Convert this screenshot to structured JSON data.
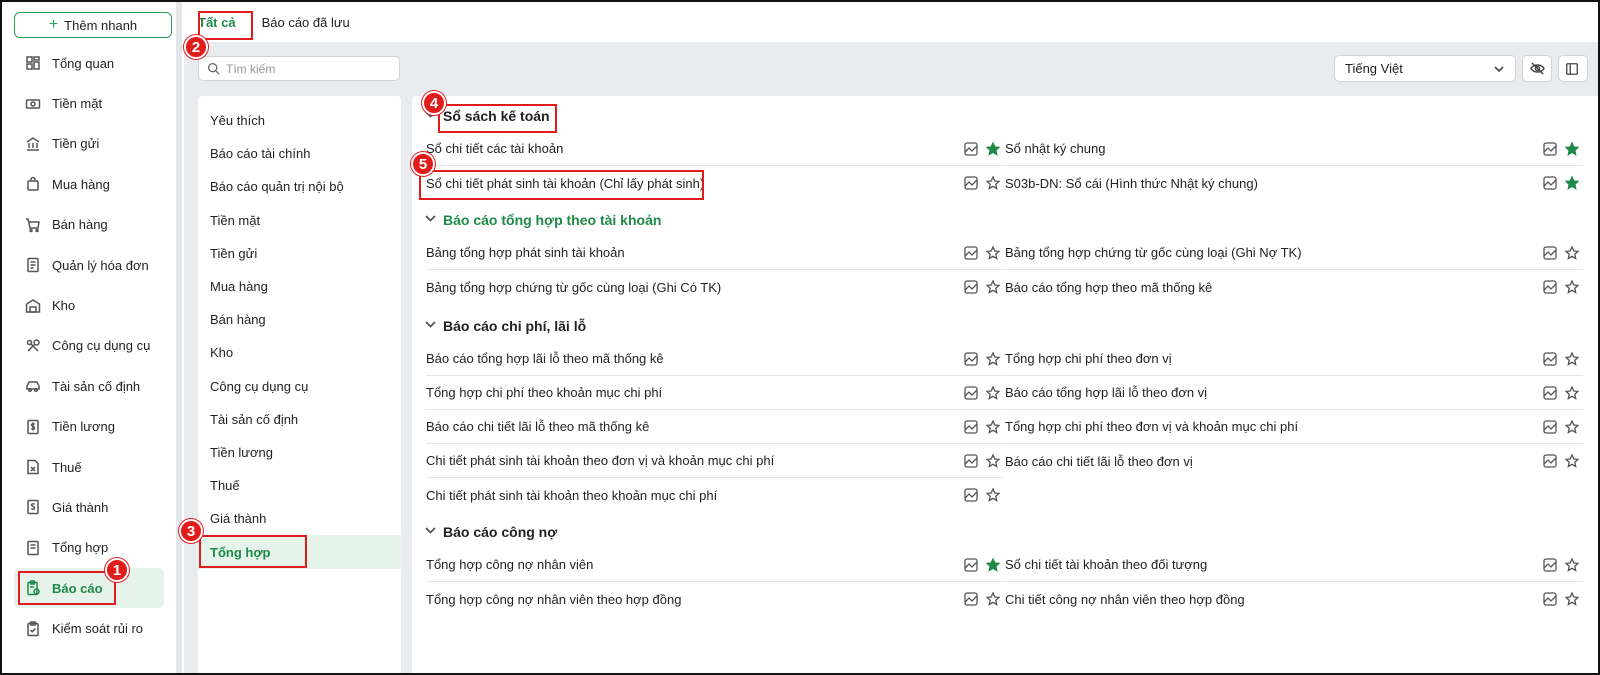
{
  "quick_add": {
    "label": "Thêm nhanh"
  },
  "sidebar": {
    "items": [
      {
        "label": "Tổng quan",
        "icon": "dashboard-icon"
      },
      {
        "label": "Tiền mặt",
        "icon": "cash-icon"
      },
      {
        "label": "Tiền gửi",
        "icon": "bank-icon"
      },
      {
        "label": "Mua hàng",
        "icon": "bag-icon"
      },
      {
        "label": "Bán hàng",
        "icon": "cart-icon"
      },
      {
        "label": "Quản lý hóa đơn",
        "icon": "invoice-icon"
      },
      {
        "label": "Kho",
        "icon": "warehouse-icon"
      },
      {
        "label": "Công cụ dụng cụ",
        "icon": "tools-icon"
      },
      {
        "label": "Tài sản cố định",
        "icon": "car-icon"
      },
      {
        "label": "Tiền lương",
        "icon": "salary-icon"
      },
      {
        "label": "Thuế",
        "icon": "tax-icon"
      },
      {
        "label": "Giá thành",
        "icon": "price-icon"
      },
      {
        "label": "Tổng hợp",
        "icon": "summary-icon"
      },
      {
        "label": "Báo cáo",
        "icon": "report-icon",
        "active": true
      },
      {
        "label": "Kiểm soát rủi ro",
        "icon": "risk-icon"
      }
    ]
  },
  "tabs": [
    {
      "label": "Tất cả",
      "active": true
    },
    {
      "label": "Báo cáo đã lưu",
      "active": false
    }
  ],
  "search": {
    "placeholder": "Tìm kiếm"
  },
  "language": {
    "value": "Tiếng Việt"
  },
  "categories": [
    "Yêu thích",
    "Báo cáo tài chính",
    "Báo cáo quản trị nội bộ",
    "Tiền mặt",
    "Tiền gửi",
    "Mua hàng",
    "Bán hàng",
    "Kho",
    "Công cụ dụng cụ",
    "Tài sản cố định",
    "Tiền lương",
    "Thuế",
    "Giá thành",
    "Tổng hợp"
  ],
  "active_category": "Tổng hợp",
  "sections": [
    {
      "title": "Sổ sách kế toán",
      "left": [
        {
          "label": "Sổ chi tiết các tài khoản",
          "fav": true
        },
        {
          "label": "Sổ chi tiết phát sinh tài khoản (Chỉ lấy phát sinh)",
          "fav": false
        }
      ],
      "right": [
        {
          "label": "Sổ nhật ký chung",
          "fav": true
        },
        {
          "label": "S03b-DN: Sổ cái (Hình thức Nhật ký chung)",
          "fav": true
        }
      ]
    },
    {
      "title": "Báo cáo tổng hợp theo tài khoản",
      "left": [
        {
          "label": "Bảng tổng hợp phát sinh tài khoản",
          "fav": false
        },
        {
          "label": "Bảng tổng hợp chứng từ gốc cùng loại (Ghi Có TK)",
          "fav": false
        }
      ],
      "right": [
        {
          "label": "Bảng tổng hợp chứng từ gốc cùng loại (Ghi Nợ TK)",
          "fav": false
        },
        {
          "label": "Báo cáo tổng hợp theo mã thống kê",
          "fav": false
        }
      ]
    },
    {
      "title": "Báo cáo chi phí, lãi lỗ",
      "left": [
        {
          "label": "Báo cáo tổng hợp lãi lỗ theo mã thống kê",
          "fav": false
        },
        {
          "label": "Tổng hợp chi phí theo khoản mục chi phí",
          "fav": false
        },
        {
          "label": "Báo cáo chi tiết lãi lỗ theo mã thống kê",
          "fav": false
        },
        {
          "label": "Chi tiết phát sinh tài khoản theo đơn vị và khoản mục chi phí",
          "fav": false
        },
        {
          "label": "Chi tiết phát sinh tài khoản theo khoản mục chi phí",
          "fav": false
        }
      ],
      "right": [
        {
          "label": "Tổng hợp chi phí theo đơn vị",
          "fav": false
        },
        {
          "label": "Báo cáo tổng hợp lãi lỗ theo đơn vị",
          "fav": false
        },
        {
          "label": "Tổng hợp chi phí theo đơn vị và khoản mục chi phí",
          "fav": false
        },
        {
          "label": "Báo cáo chi tiết lãi lỗ theo đơn vị",
          "fav": false
        }
      ]
    },
    {
      "title": "Báo cáo công nợ",
      "left": [
        {
          "label": "Tổng hợp công nợ nhân viên",
          "fav": true
        },
        {
          "label": "Tổng hợp công nợ nhân viên theo hợp đồng",
          "fav": false
        }
      ],
      "right": [
        {
          "label": "Sổ chi tiết tài khoản theo đối tượng",
          "fav": false
        },
        {
          "label": "Chi tiết công nợ nhân viên theo hợp đồng",
          "fav": false
        }
      ]
    }
  ],
  "annotations": [
    "1",
    "2",
    "3",
    "4",
    "5"
  ],
  "colors": {
    "accent": "#1e8a47",
    "annotation": "#e21b1b",
    "background": "#e9ecef"
  }
}
